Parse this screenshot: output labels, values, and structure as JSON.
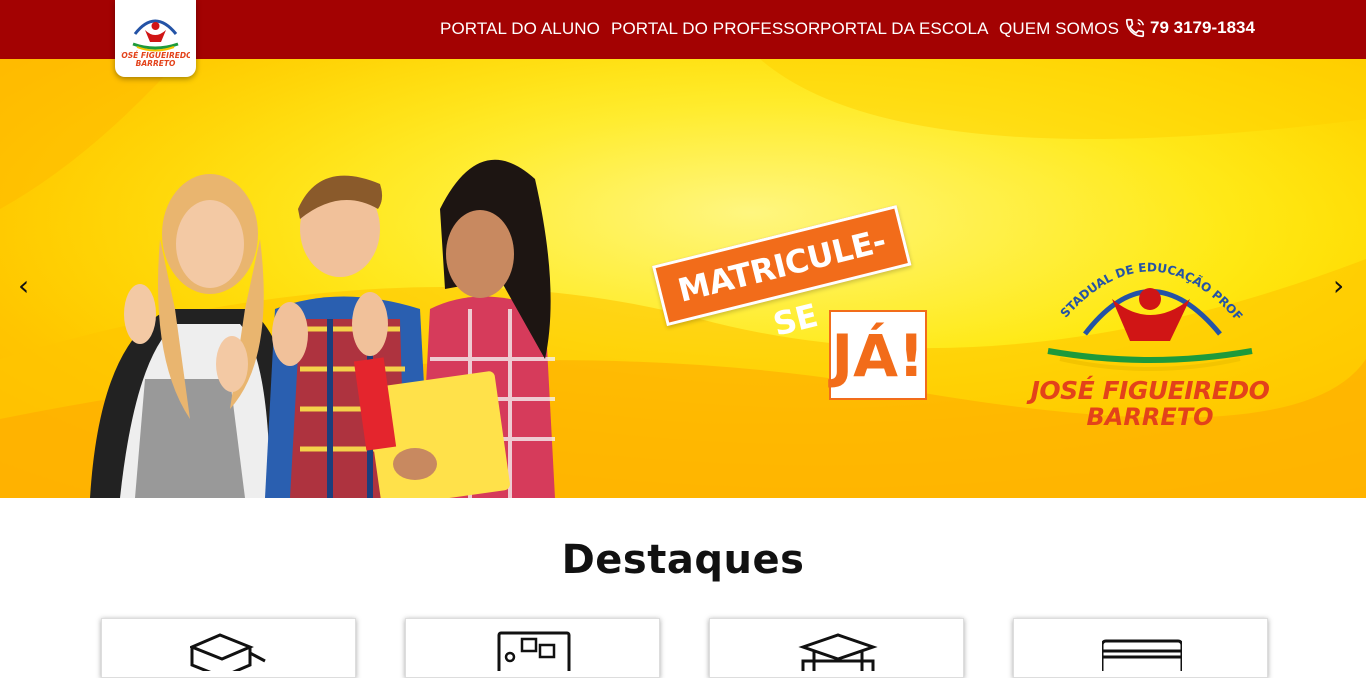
{
  "nav": {
    "logo_name_line1": "JOSÉ FIGUEIREDO",
    "logo_name_line2": "BARRETO",
    "links": [
      "PORTAL DO ALUNO",
      "PORTAL DO PROFESSOR",
      "PORTAL DA ESCOLA",
      "QUEM SOMOS"
    ],
    "phone": "79 3179-1834",
    "phone_icon": "phone-icon"
  },
  "hero": {
    "banner_text": "MATRICULE-SE",
    "banner_text2": "JÁ!",
    "logo_arc_text": "CENTRO ESTADUAL DE EDUCAÇÃO PROFISSIONAL",
    "logo_name_line1": "JOSÉ FIGUEIREDO",
    "logo_name_line2": "BARRETO",
    "prev_arrow": "‹",
    "next_arrow": "›"
  },
  "section": {
    "title": "Destaques"
  },
  "cards": [
    {
      "icon": "books-icon"
    },
    {
      "icon": "bulletin-board-icon"
    },
    {
      "icon": "graduation-cap-icon"
    },
    {
      "icon": "card-icon"
    }
  ],
  "colors": {
    "nav_bg": "#a30202",
    "accent_orange": "#f26c1a",
    "hero_yellow": "#ffe600"
  }
}
